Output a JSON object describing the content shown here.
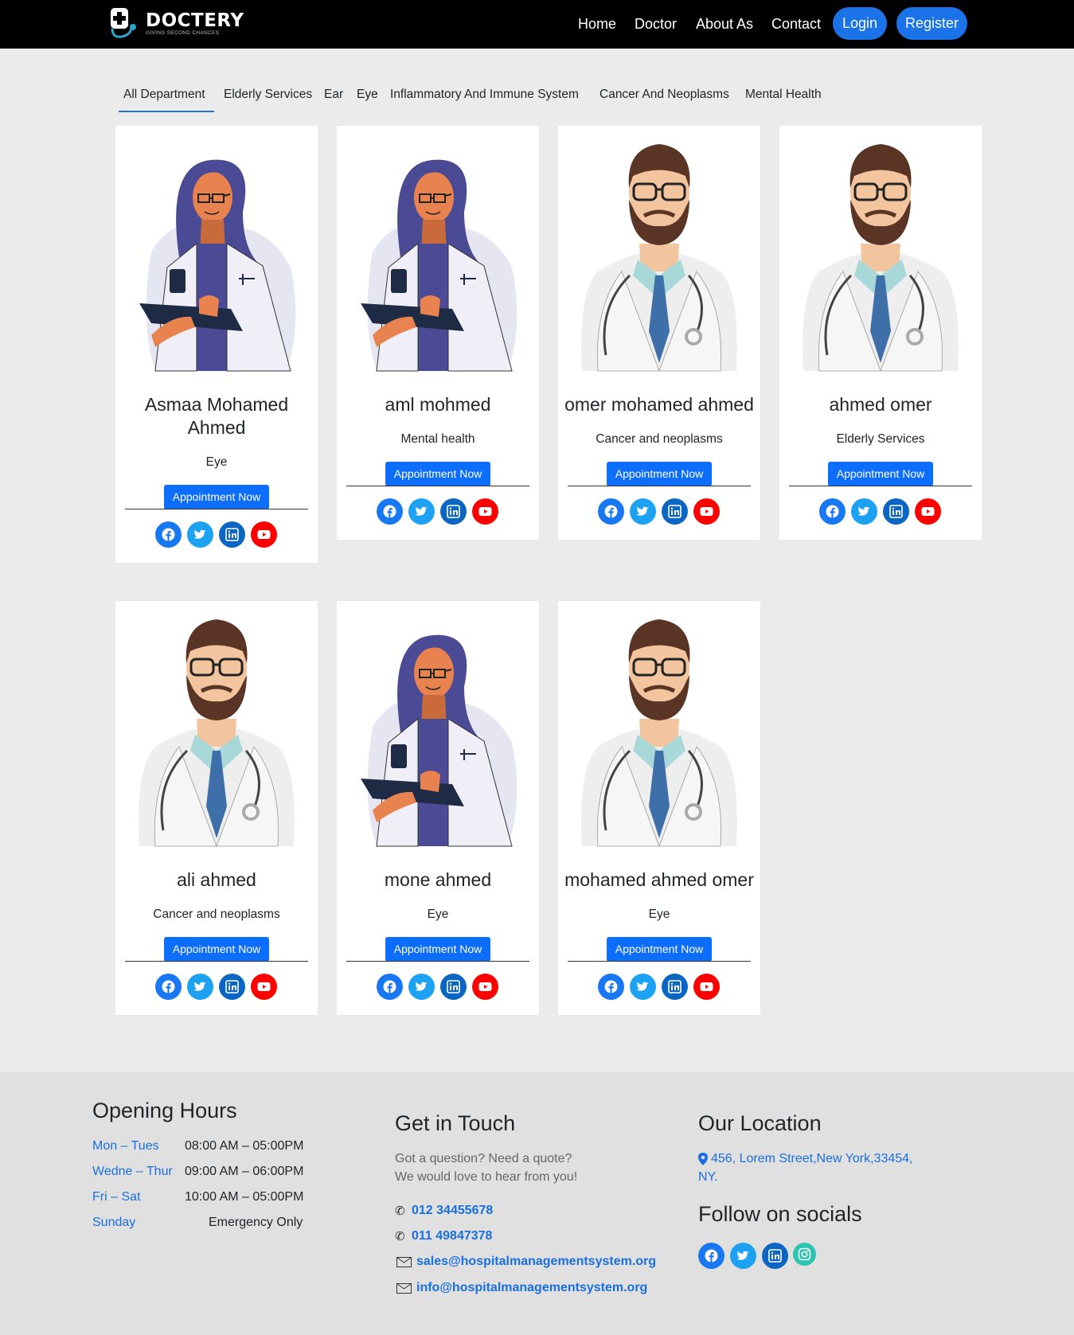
{
  "brand": {
    "name": "DOCTERY",
    "tagline": "GIVING SECOND CHANCES"
  },
  "nav": {
    "links": [
      "Home",
      "Doctor",
      "About As",
      "Contact"
    ],
    "login": "Login",
    "register": "Register"
  },
  "tabs": [
    "All Department",
    "Elderly Services",
    "Ear",
    "Eye",
    "Inflammatory And Immune System",
    "Cancer And Neoplasms",
    "Mental Health"
  ],
  "active_tab": "All Department",
  "doctors": [
    {
      "name": "Asmaa Mohamed Ahmed",
      "department": "Eye",
      "avatar": "female-doctor-illustration",
      "button": "Appointment Now"
    },
    {
      "name": "aml mohmed",
      "department": "Mental health",
      "avatar": "female-doctor-illustration",
      "button": "Appointment Now"
    },
    {
      "name": "omer mohamed ahmed",
      "department": "Cancer and neoplasms",
      "avatar": "male-doctor-illustration",
      "button": "Appointment Now"
    },
    {
      "name": "ahmed omer",
      "department": "Elderly Services",
      "avatar": "male-doctor-illustration",
      "button": "Appointment Now"
    },
    {
      "name": "ali ahmed",
      "department": "Cancer and neoplasms",
      "avatar": "male-doctor-illustration",
      "button": "Appointment Now"
    },
    {
      "name": "mone ahmed",
      "department": "Eye",
      "avatar": "female-doctor-illustration",
      "button": "Appointment Now"
    },
    {
      "name": "mohamed ahmed omer",
      "department": "Eye",
      "avatar": "male-doctor-illustration",
      "button": "Appointment Now"
    }
  ],
  "card_social_icons": [
    "facebook-icon",
    "twitter-icon",
    "linkedin-icon",
    "youtube-icon"
  ],
  "footer": {
    "opening": {
      "title": "Opening Hours",
      "rows": [
        {
          "day": "Mon – Tues",
          "hours": "08:00 AM – 05:00PM"
        },
        {
          "day": "Wedne – Thur",
          "hours": "09:00 AM – 06:00PM"
        },
        {
          "day": "Fri – Sat",
          "hours": "10:00 AM – 05:00PM"
        },
        {
          "day": "Sunday",
          "hours": "Emergency Only"
        }
      ]
    },
    "contact": {
      "title": "Get in Touch",
      "line1": "Got a question? Need a quote?",
      "line2": "We would love to hear from you!",
      "phone1": "012 34455678",
      "phone2": "011 49847378",
      "email1": "sales@hospitalmanagementsystem.org",
      "email2": "info@hospitalmanagementsystem.org"
    },
    "location": {
      "title": "Our Location",
      "address_line1": "456, Lorem Street,New York,33454,",
      "address_line2": "NY.",
      "socials_title": "Follow on socials",
      "socials": [
        "facebook-icon",
        "twitter-icon",
        "linkedin-icon",
        "instagram-icon"
      ]
    }
  },
  "colors": {
    "primary": "#0d6efd",
    "nav_btn": "#1a73e8",
    "link": "#1a6fe0",
    "facebook": "#1877f2",
    "twitter": "#1da1f2",
    "linkedin": "#0a66c2",
    "youtube": "#ff0000",
    "instagram": "#2bc4b0"
  }
}
